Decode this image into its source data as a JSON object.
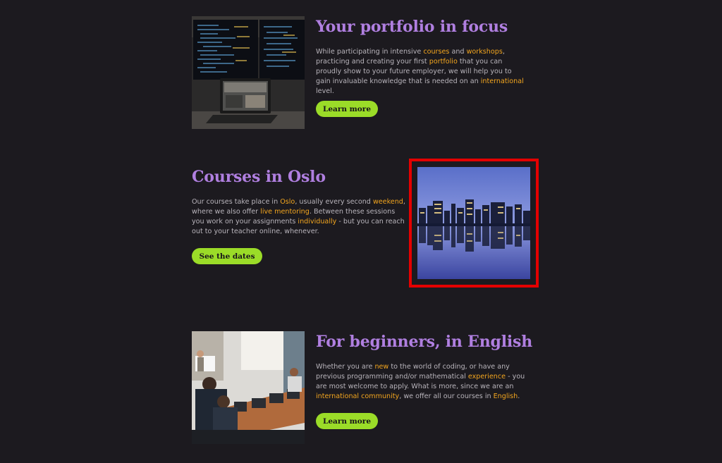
{
  "sections": [
    {
      "title": "Your portfolio in focus",
      "body": [
        {
          "t": "While participating in intensive "
        },
        {
          "t": "courses",
          "hl": true
        },
        {
          "t": " and "
        },
        {
          "t": "workshops",
          "hl": true
        },
        {
          "t": ", practicing and creating your first "
        },
        {
          "t": "portfolio",
          "hl": true
        },
        {
          "t": " that you can proudly show to your future employer, we will help you to gain invaluable knowledge that is needed on an "
        },
        {
          "t": "international",
          "hl": true
        },
        {
          "t": " level."
        }
      ],
      "button": "Learn more",
      "image_icon": "monitors-laptop-photo"
    },
    {
      "title": "Courses in Oslo",
      "body": [
        {
          "t": "Our courses take place in "
        },
        {
          "t": "Oslo",
          "hl": true
        },
        {
          "t": ", usually every second "
        },
        {
          "t": "weekend",
          "hl": true
        },
        {
          "t": ", where we also offer "
        },
        {
          "t": "live mentoring",
          "hl": true
        },
        {
          "t": ". Between these sessions you work on your assignments "
        },
        {
          "t": "individually",
          "hl": true
        },
        {
          "t": " - but you can reach out to your teacher online, whenever."
        }
      ],
      "button": "See the dates",
      "image_icon": "oslo-skyline-photo"
    },
    {
      "title": "For beginners, in English",
      "body": [
        {
          "t": "Whether you are "
        },
        {
          "t": "new",
          "hl": true
        },
        {
          "t": " to the world of coding, or have any previous programming and/or mathematical "
        },
        {
          "t": "experience",
          "hl": true
        },
        {
          "t": " - you are most welcome to apply. What is more, since we are an "
        },
        {
          "t": "international community",
          "hl": true
        },
        {
          "t": ", we offer all our courses in "
        },
        {
          "t": "English",
          "hl": true
        },
        {
          "t": "."
        }
      ],
      "button": "Learn more",
      "image_icon": "classroom-photo"
    }
  ],
  "colors": {
    "background": "#1c1a1f",
    "heading": "#b07fe0",
    "highlight": "#f2a51f",
    "button": "#9bdc28",
    "focus_outline": "#e40000"
  }
}
